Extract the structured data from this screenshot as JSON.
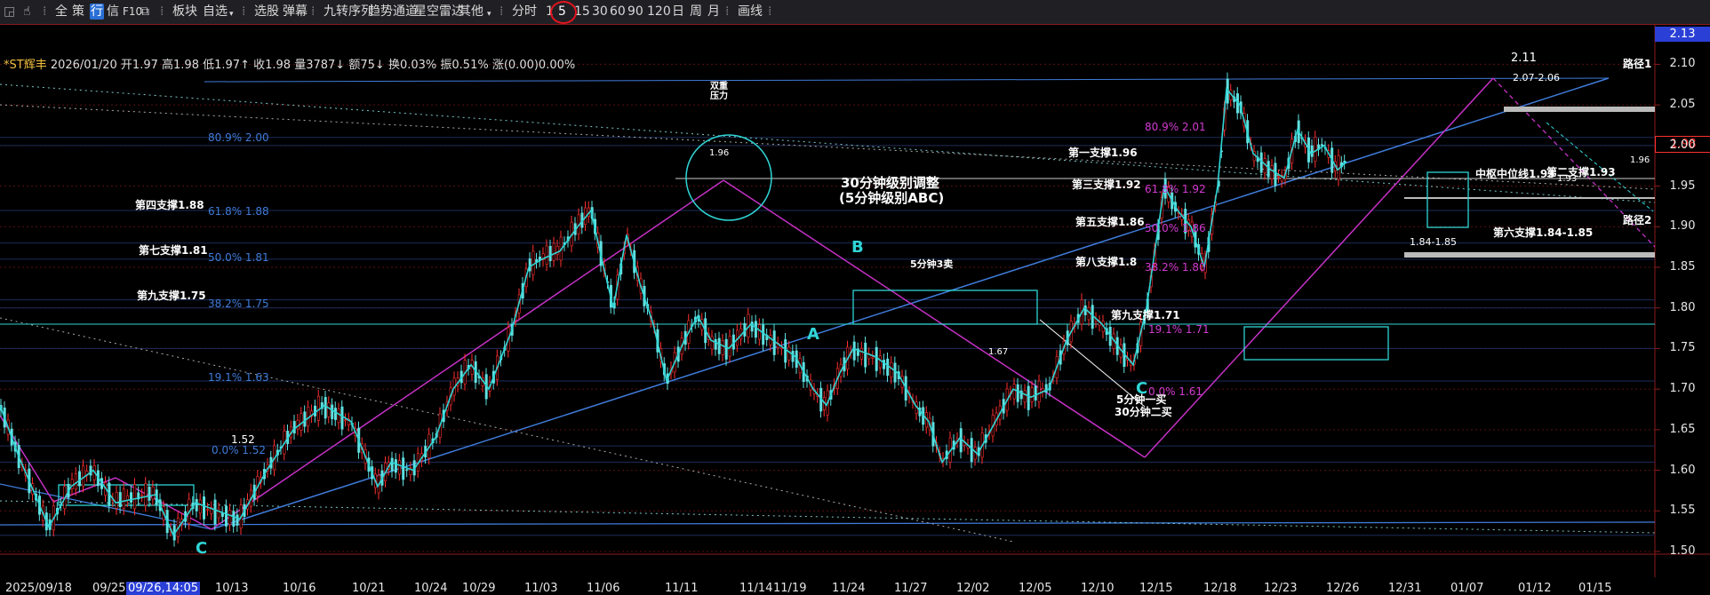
{
  "toolbar": {
    "items": [
      "全",
      "策",
      "行",
      "信",
      "F10",
      "板块",
      "自选",
      "选股",
      "弹幕",
      "九转序列",
      "趋势通道",
      "星空雷达",
      "其他",
      "分时",
      "1",
      "5",
      "15",
      "30",
      "60",
      "90",
      "120",
      "日",
      "周",
      "月",
      "画线"
    ]
  },
  "header": {
    "stock": "*ST辉丰",
    "date": "2026/01/20",
    "open": "开1.97",
    "high": "高1.98",
    "low": "低1.97",
    "close": "收1.98",
    "volume": "量3787",
    "amount": "额75",
    "turnover": "换0.03%",
    "amplitude": "振0.51%",
    "change": "涨(0.00)0.00%"
  },
  "colors": {
    "up": "#ff3030",
    "down": "#5fe0e0",
    "wave": "#2fd5d5",
    "trend_magenta": "#c531c5",
    "trend_blue": "#3f7bd9",
    "price_badge": "#ff3030",
    "axis_top_badge": "#2a3fd6"
  },
  "chart_data": {
    "type": "candlestick",
    "period": "5分钟",
    "ylim": [
      1.5,
      2.13
    ],
    "y_ticks": [
      1.5,
      1.55,
      1.6,
      1.65,
      1.7,
      1.75,
      1.8,
      1.85,
      1.9,
      1.95,
      2.0,
      2.05,
      2.1
    ],
    "top_value": "2.13",
    "last_price": "1.98",
    "x_labels": [
      "2025/09/18",
      "09/25",
      "09/26,14:05",
      "10/13",
      "10/16",
      "10/21",
      "10/24",
      "10/29",
      "11/03",
      "11/06",
      "11/11",
      "11/14",
      "11/19",
      "11/24",
      "11/27",
      "12/02",
      "12/05",
      "12/10",
      "12/15",
      "12/18",
      "12/23",
      "12/26",
      "12/31",
      "01/07",
      "01/12",
      "01/15"
    ],
    "extrema_labels": [
      "2.11",
      "1.96",
      "1.52",
      "1.67",
      "1.93",
      "1.96",
      "2.07-2.06",
      "1.84-1.85"
    ],
    "fib_levels": [
      {
        "label": "80.9% 2.00",
        "value": 2.0
      },
      {
        "label": "61.8% 1.88",
        "value": 1.88
      },
      {
        "label": "50.0% 1.81",
        "value": 1.81
      },
      {
        "label": "38.2% 1.75",
        "value": 1.75
      },
      {
        "label": "19.1% 1.63",
        "value": 1.63
      },
      {
        "label": "0.0% 1.52",
        "value": 1.52
      }
    ],
    "fib_levels_right": [
      {
        "label": "80.9% 2.01",
        "value": 2.01
      },
      {
        "label": "61.8% 1.92",
        "value": 1.92
      },
      {
        "label": "50.0% 1.86",
        "value": 1.86
      },
      {
        "label": "38.2% 1.80",
        "value": 1.8
      },
      {
        "label": "19.1% 1.71",
        "value": 1.71
      },
      {
        "label": "0.0% 1.61",
        "value": 1.61
      }
    ],
    "supports": [
      {
        "label": "第一支撑1.96",
        "value": 1.96
      },
      {
        "label": "第二支撑1.93",
        "value": 1.93
      },
      {
        "label": "第三支撑1.92",
        "value": 1.92
      },
      {
        "label": "第四支撑1.88",
        "value": 1.88
      },
      {
        "label": "第五支撑1.86",
        "value": 1.86
      },
      {
        "label": "第六支撑1.84-1.85",
        "value": 1.845
      },
      {
        "label": "第七支撑1.81",
        "value": 1.81
      },
      {
        "label": "第八支撑1.8",
        "value": 1.8
      },
      {
        "label": "第九支撑1.75",
        "value": 1.75
      },
      {
        "label": "第九支撑1.71",
        "value": 1.71
      }
    ],
    "annotations": {
      "adjust_title": "30分钟级别调整",
      "adjust_sub": "(5分钟级别ABC)",
      "double_top": "双重",
      "double_top2": "压力",
      "wave_a": "A",
      "wave_b": "B",
      "wave_c": "C",
      "wave_c2": "C",
      "buy1": "5分钟一买",
      "buy2": "30分钟二买",
      "box_label": "5分钟3卖",
      "midline": "中枢中位线1.93",
      "path1": "路径1",
      "path2": "路径2"
    },
    "series": [
      {
        "name": "price",
        "points": [
          [
            0,
            1.68
          ],
          [
            20,
            1.62
          ],
          [
            55,
            1.53
          ],
          [
            80,
            1.58
          ],
          [
            105,
            1.6
          ],
          [
            130,
            1.56
          ],
          [
            175,
            1.57
          ],
          [
            195,
            1.52
          ],
          [
            220,
            1.56
          ],
          [
            245,
            1.55
          ],
          [
            270,
            1.54
          ],
          [
            300,
            1.6
          ],
          [
            330,
            1.65
          ],
          [
            365,
            1.68
          ],
          [
            395,
            1.66
          ],
          [
            410,
            1.62
          ],
          [
            425,
            1.58
          ],
          [
            440,
            1.61
          ],
          [
            465,
            1.6
          ],
          [
            490,
            1.64
          ],
          [
            510,
            1.7
          ],
          [
            530,
            1.73
          ],
          [
            550,
            1.7
          ],
          [
            575,
            1.77
          ],
          [
            595,
            1.85
          ],
          [
            610,
            1.86
          ],
          [
            630,
            1.87
          ],
          [
            650,
            1.9
          ],
          [
            665,
            1.92
          ],
          [
            675,
            1.87
          ],
          [
            690,
            1.8
          ],
          [
            705,
            1.89
          ],
          [
            720,
            1.83
          ],
          [
            735,
            1.78
          ],
          [
            750,
            1.71
          ],
          [
            770,
            1.76
          ],
          [
            785,
            1.79
          ],
          [
            800,
            1.76
          ],
          [
            820,
            1.75
          ],
          [
            845,
            1.78
          ],
          [
            870,
            1.76
          ],
          [
            895,
            1.74
          ],
          [
            915,
            1.7
          ],
          [
            930,
            1.68
          ],
          [
            945,
            1.72
          ],
          [
            960,
            1.75
          ],
          [
            985,
            1.74
          ],
          [
            1010,
            1.72
          ],
          [
            1030,
            1.68
          ],
          [
            1045,
            1.66
          ],
          [
            1060,
            1.61
          ],
          [
            1080,
            1.64
          ],
          [
            1100,
            1.62
          ],
          [
            1120,
            1.66
          ],
          [
            1140,
            1.7
          ],
          [
            1160,
            1.69
          ],
          [
            1180,
            1.7
          ],
          [
            1200,
            1.76
          ],
          [
            1220,
            1.8
          ],
          [
            1240,
            1.78
          ],
          [
            1260,
            1.75
          ],
          [
            1275,
            1.73
          ],
          [
            1290,
            1.8
          ],
          [
            1310,
            1.95
          ],
          [
            1325,
            1.92
          ],
          [
            1340,
            1.9
          ],
          [
            1355,
            1.85
          ],
          [
            1370,
            1.95
          ],
          [
            1380,
            2.07
          ],
          [
            1395,
            2.05
          ],
          [
            1410,
            1.99
          ],
          [
            1430,
            1.97
          ],
          [
            1445,
            1.96
          ],
          [
            1460,
            2.02
          ],
          [
            1475,
            1.99
          ],
          [
            1490,
            2.0
          ],
          [
            1505,
            1.97
          ],
          [
            1515,
            1.98
          ]
        ]
      }
    ]
  }
}
